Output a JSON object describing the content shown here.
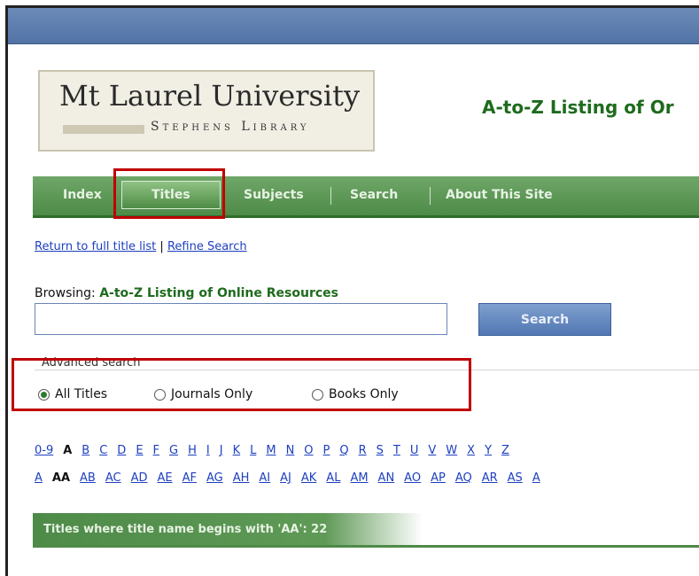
{
  "logo": {
    "title": "Mt Laurel University",
    "subtitle": "Stephens Library"
  },
  "page_heading": "A-to-Z Listing of Or",
  "nav": [
    {
      "label": "Index"
    },
    {
      "label": "Titles"
    },
    {
      "label": "Subjects"
    },
    {
      "label": "Search"
    },
    {
      "label": "About This Site"
    }
  ],
  "links": {
    "return": "Return to full title list",
    "separator": "|",
    "refine": "Refine Search"
  },
  "browsing": {
    "prefix": "Browsing:",
    "value": "A-to-Z Listing of Online Resources"
  },
  "search": {
    "value": "",
    "button": "Search"
  },
  "advanced_label": "Advanced search",
  "filters": [
    {
      "label": "All Titles",
      "selected": true
    },
    {
      "label": "Journals Only",
      "selected": false
    },
    {
      "label": "Books Only",
      "selected": false
    }
  ],
  "alpha_row1": [
    "0-9",
    "A",
    "B",
    "C",
    "D",
    "E",
    "F",
    "G",
    "H",
    "I",
    "J",
    "K",
    "L",
    "M",
    "N",
    "O",
    "P",
    "Q",
    "R",
    "S",
    "T",
    "U",
    "V",
    "W",
    "X",
    "Y",
    "Z"
  ],
  "alpha_row1_current": "A",
  "alpha_row2": [
    "A",
    "AA",
    "AB",
    "AC",
    "AD",
    "AE",
    "AF",
    "AG",
    "AH",
    "AI",
    "AJ",
    "AK",
    "AL",
    "AM",
    "AN",
    "AO",
    "AP",
    "AQ",
    "AR",
    "AS",
    "A"
  ],
  "alpha_row2_current": "AA",
  "results_text": "Titles where title name begins with 'AA': 22",
  "colors": {
    "nav_green": "#4e8a48",
    "heading_green": "#1e6b1e",
    "highlight_red": "#c00000",
    "link_blue": "#1d3fbf",
    "top_band": "#5173a6"
  }
}
